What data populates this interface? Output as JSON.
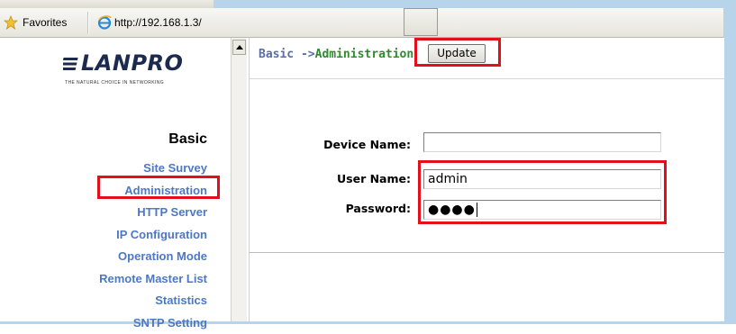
{
  "browser": {
    "favorites_label": "Favorites",
    "url": "http://192.168.1.3/"
  },
  "brand": {
    "logo_text": "LANPRO",
    "tagline": "THE NATURAL CHOICE IN NETWORKING"
  },
  "nav": {
    "title": "Basic",
    "items": [
      {
        "label": "Site Survey"
      },
      {
        "label": "Administration",
        "selected": true
      },
      {
        "label": "HTTP Server"
      },
      {
        "label": "IP Configuration"
      },
      {
        "label": "Operation Mode"
      },
      {
        "label": "Remote Master List"
      },
      {
        "label": "Statistics"
      },
      {
        "label": "SNTP Setting"
      }
    ]
  },
  "main": {
    "breadcrumb_prefix": "Basic ->",
    "breadcrumb_current": "Administration",
    "update_button": "Update",
    "fields": {
      "device_name": {
        "label": "Device Name:",
        "value": ""
      },
      "user_name": {
        "label": "User Name:",
        "value": "admin"
      },
      "password": {
        "label": "Password:",
        "masked_value": "●●●●"
      }
    }
  },
  "colors": {
    "highlight_red": "#e3101b",
    "nav_link_blue": "#4c78c4",
    "breadcrumb_green": "#2e8b2e",
    "frame_blue": "#b7d4ea"
  }
}
